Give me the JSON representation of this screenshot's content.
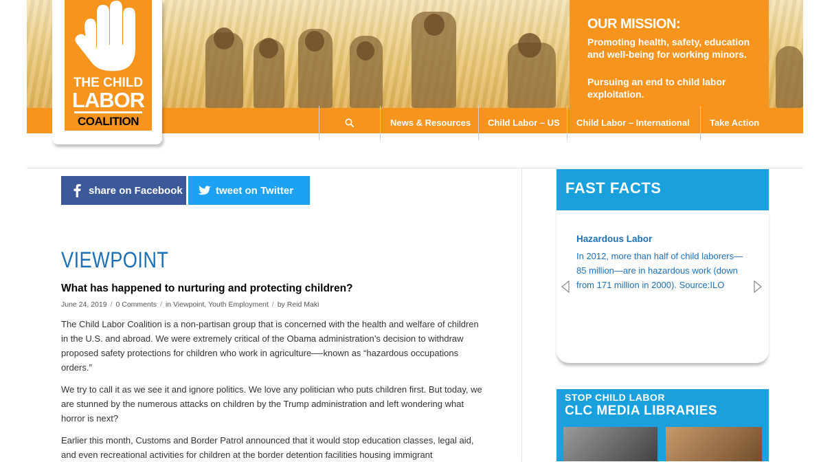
{
  "mission": {
    "heading": "OUR MISSION:",
    "line1": "Promoting health, safety, education and well-being for working minors.",
    "line2": "Pursuing an end to child labor exploitation."
  },
  "logo": {
    "line1": "THE CHILD",
    "line2": "LABOR",
    "line3": "COALITION"
  },
  "nav": {
    "items": [
      {
        "label": "News & Resources"
      },
      {
        "label": "Child Labor – US"
      },
      {
        "label": "Child Labor – International"
      },
      {
        "label": "Take Action"
      }
    ],
    "search_icon": "search-icon"
  },
  "share": {
    "facebook": "share on Facebook",
    "twitter": "tweet on Twitter"
  },
  "article": {
    "category": "VIEWPOINT",
    "title": "What has happened to nurturing and protecting children?",
    "date": "June 24, 2019",
    "comments": "0 Comments",
    "in_prefix": "in",
    "categories_a": "Viewpoint",
    "categories_b": "Youth Employment",
    "by_prefix": "by",
    "author": "Reid Maki",
    "paragraphs": [
      "The Child Labor Coalition is a non-partisan group that is concerned with the health and welfare of children in the U.S. and abroad. We were extremely critical of the Obama administration’s decision to withdraw proposed safety protections for children who work in agriculture—-known as “hazardous occupations orders.”",
      "We try to call it as we see it and ignore politics. We love any politician who puts children first. But today, we are stunned by the numerous attacks on children by the Trump administration and left wondering what horror is next?",
      "Earlier this month, Customs and Border Patrol announced that it would stop education classes, legal aid, and even recreational activities for children at the border detention facilities housing immigrant"
    ]
  },
  "fast_facts": {
    "heading": "FAST FACTS",
    "title": "Hazardous Labor",
    "text": "In 2012, more than half of child laborers—85 million—are in hazardous work (down from 171 million in 2000). Source:ILO"
  },
  "media_library": {
    "line1": "STOP CHILD LABOR",
    "line2": "CLC MEDIA LIBRARIES"
  },
  "colors": {
    "orange": "#f7941d",
    "blue_link": "#1d70b7",
    "facebook": "#3b5998",
    "twitter": "#1da1f2",
    "fastfacts_bg": "#1aa0dc"
  }
}
